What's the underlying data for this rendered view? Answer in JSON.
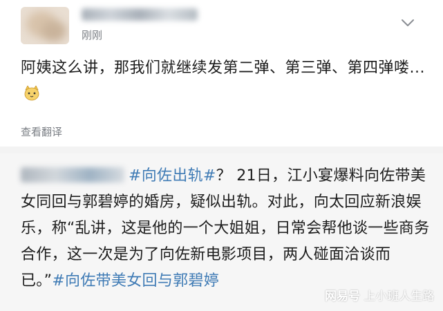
{
  "post": {
    "username": "",
    "timestamp": "刚刚",
    "content": "阿姨这么讲，那我们就继续发第二弹、第三弹、第四弹喽...",
    "translate_label": "查看翻译"
  },
  "quote": {
    "hashtag1": "#向佐出轨#",
    "text": "？ 21日，江小宴爆料向佐带美女同回与郭碧婷的婚房，疑似出轨。对此，向太回应新浪娱乐，称“乱讲，这是他的一个大姐姐，日常会帮他谈一些商务合作，这一次是为了向佐新电影项目，两人碰面洽谈而已。”",
    "hashtag2": "#向佐带美女回与郭碧婷"
  },
  "watermark": {
    "brand": "网易号",
    "author": "上小班人生路"
  },
  "colors": {
    "hashtag": "#3f7bb5",
    "muted_text": "#7b7f85",
    "quote_bg": "#f6f6f6"
  },
  "icons": {
    "more": "chevron-down-icon",
    "emoji": "cat-face-icon"
  }
}
